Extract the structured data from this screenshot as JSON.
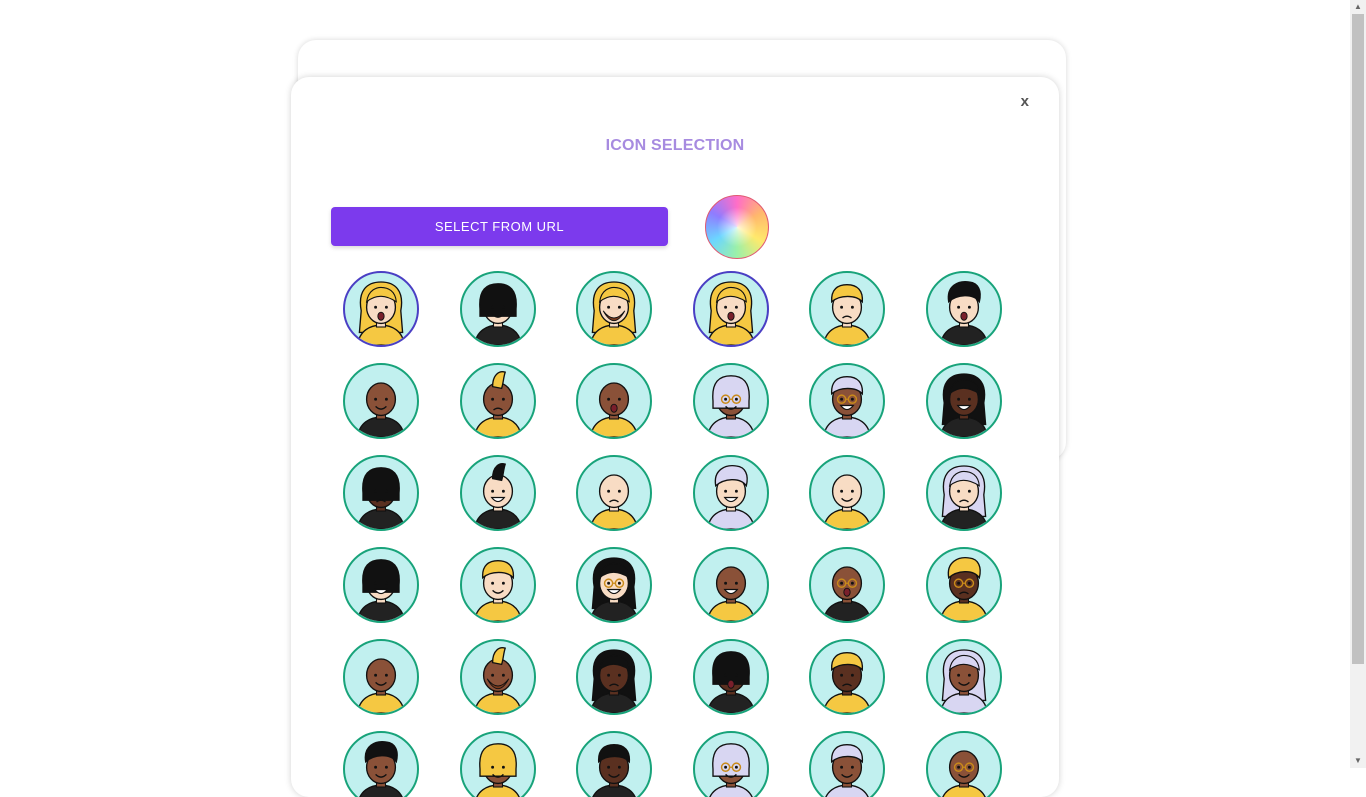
{
  "modal": {
    "close_label": "x",
    "title": "ICON SELECTION",
    "select_url_label": "SELECT FROM URL"
  },
  "colors": {
    "accent": "#7c3aed",
    "title": "#a78be0",
    "avatar_bg": "#c1f0ef",
    "avatar_border": "#18a37a",
    "avatar_selected_border": "#4a3fc4"
  },
  "avatars": [
    {
      "skin": "#f8dcc4",
      "hair": "#f5c842",
      "style": "long",
      "shirt": "#f5c842",
      "mouth": "o",
      "selected": true
    },
    {
      "skin": "#f8dcc4",
      "hair": "#111111",
      "style": "bob",
      "shirt": "#222222",
      "mouth": "smile",
      "selected": false
    },
    {
      "skin": "#f8dcc4",
      "hair": "#f5c842",
      "style": "long",
      "shirt": "#f5c842",
      "mouth": "beard",
      "selected": false
    },
    {
      "skin": "#f8dcc4",
      "hair": "#f5c842",
      "style": "long",
      "shirt": "#f5c842",
      "mouth": "o",
      "selected": true
    },
    {
      "skin": "#f8dcc4",
      "hair": "#f5c842",
      "style": "short",
      "shirt": "#f5c842",
      "mouth": "frown",
      "selected": false
    },
    {
      "skin": "#f8dcc4",
      "hair": "#111111",
      "style": "quiff",
      "shirt": "#222222",
      "mouth": "o",
      "selected": false
    },
    {
      "skin": "#8a5138",
      "hair": "none",
      "style": "bald",
      "shirt": "#222222",
      "mouth": "smile",
      "selected": false
    },
    {
      "skin": "#8a5138",
      "hair": "#f5c842",
      "style": "mohawk",
      "shirt": "#f5c842",
      "mouth": "frown",
      "selected": false
    },
    {
      "skin": "#8a5138",
      "hair": "none",
      "style": "bald",
      "shirt": "#f5c842",
      "mouth": "o",
      "selected": false
    },
    {
      "skin": "#8a5138",
      "hair": "#d8d6f2",
      "style": "bob",
      "shirt": "#d8d6f2",
      "mouth": "smile",
      "glasses": true,
      "selected": false
    },
    {
      "skin": "#8a5138",
      "hair": "#d8d6f2",
      "style": "short",
      "shirt": "#d8d6f2",
      "mouth": "grin",
      "glasses": true,
      "selected": false
    },
    {
      "skin": "#5a3020",
      "hair": "#111111",
      "style": "long",
      "shirt": "#222222",
      "mouth": "grin",
      "selected": false
    },
    {
      "skin": "#5a3020",
      "hair": "#111111",
      "style": "bob",
      "shirt": "#222222",
      "mouth": "frown",
      "selected": false
    },
    {
      "skin": "#f8dcc4",
      "hair": "#111111",
      "style": "mohawk",
      "shirt": "#222222",
      "mouth": "grin",
      "selected": false
    },
    {
      "skin": "#f8dcc4",
      "hair": "none",
      "style": "bald",
      "shirt": "#f5c842",
      "mouth": "frown",
      "selected": false
    },
    {
      "skin": "#f8dcc4",
      "hair": "#d8d6f2",
      "style": "quiff",
      "shirt": "#d8d6f2",
      "mouth": "grin",
      "selected": false
    },
    {
      "skin": "#f8dcc4",
      "hair": "none",
      "style": "bald",
      "shirt": "#f5c842",
      "mouth": "smile",
      "selected": false
    },
    {
      "skin": "#f8dcc4",
      "hair": "#d8d6f2",
      "style": "long",
      "shirt": "#222222",
      "mouth": "frown",
      "selected": false
    },
    {
      "skin": "#f8dcc4",
      "hair": "#111111",
      "style": "bob",
      "shirt": "#222222",
      "mouth": "grin",
      "selected": false
    },
    {
      "skin": "#f8dcc4",
      "hair": "#f5c842",
      "style": "short",
      "shirt": "#f5c842",
      "mouth": "smile",
      "selected": false
    },
    {
      "skin": "#f8dcc4",
      "hair": "#111111",
      "style": "long",
      "shirt": "#222222",
      "mouth": "grin",
      "glasses": true,
      "selected": false
    },
    {
      "skin": "#8a5138",
      "hair": "none",
      "style": "bald",
      "shirt": "#f5c842",
      "mouth": "grin",
      "selected": false
    },
    {
      "skin": "#8a5138",
      "hair": "none",
      "style": "bald",
      "shirt": "#222222",
      "mouth": "o",
      "glasses": true,
      "selected": false
    },
    {
      "skin": "#5a3020",
      "hair": "#f5c842",
      "style": "quiff",
      "shirt": "#f5c842",
      "mouth": "frown",
      "glasses": true,
      "selected": false
    },
    {
      "skin": "#8a5138",
      "hair": "none",
      "style": "bald",
      "shirt": "#f5c842",
      "mouth": "smile",
      "selected": false
    },
    {
      "skin": "#8a5138",
      "hair": "#f5c842",
      "style": "mohawk",
      "shirt": "#f5c842",
      "mouth": "beard",
      "selected": false
    },
    {
      "skin": "#5a3020",
      "hair": "#111111",
      "style": "long",
      "shirt": "#222222",
      "mouth": "frown",
      "selected": false
    },
    {
      "skin": "#5a3020",
      "hair": "#111111",
      "style": "bob",
      "shirt": "#222222",
      "mouth": "o",
      "selected": false
    },
    {
      "skin": "#5a3020",
      "hair": "#f5c842",
      "style": "short",
      "shirt": "#f5c842",
      "mouth": "frown",
      "selected": false
    },
    {
      "skin": "#8a5138",
      "hair": "#d8d6f2",
      "style": "long",
      "shirt": "#d8d6f2",
      "mouth": "smile",
      "selected": false
    },
    {
      "skin": "#8a5138",
      "hair": "#111111",
      "style": "quiff",
      "shirt": "#222222",
      "mouth": "smile",
      "selected": false
    },
    {
      "skin": "#8a5138",
      "hair": "#f5c842",
      "style": "bob",
      "shirt": "#f5c842",
      "mouth": "smile",
      "selected": false
    },
    {
      "skin": "#5a3020",
      "hair": "#111111",
      "style": "short",
      "shirt": "#222222",
      "mouth": "smile",
      "selected": false
    },
    {
      "skin": "#8a5138",
      "hair": "#d8d6f2",
      "style": "bob",
      "shirt": "#d8d6f2",
      "mouth": "smile",
      "glasses": true,
      "selected": false
    },
    {
      "skin": "#8a5138",
      "hair": "#d8d6f2",
      "style": "short",
      "shirt": "#d8d6f2",
      "mouth": "smile",
      "selected": false
    },
    {
      "skin": "#8a5138",
      "hair": "none",
      "style": "bald",
      "shirt": "#f5c842",
      "mouth": "smile",
      "glasses": true,
      "selected": false
    }
  ]
}
